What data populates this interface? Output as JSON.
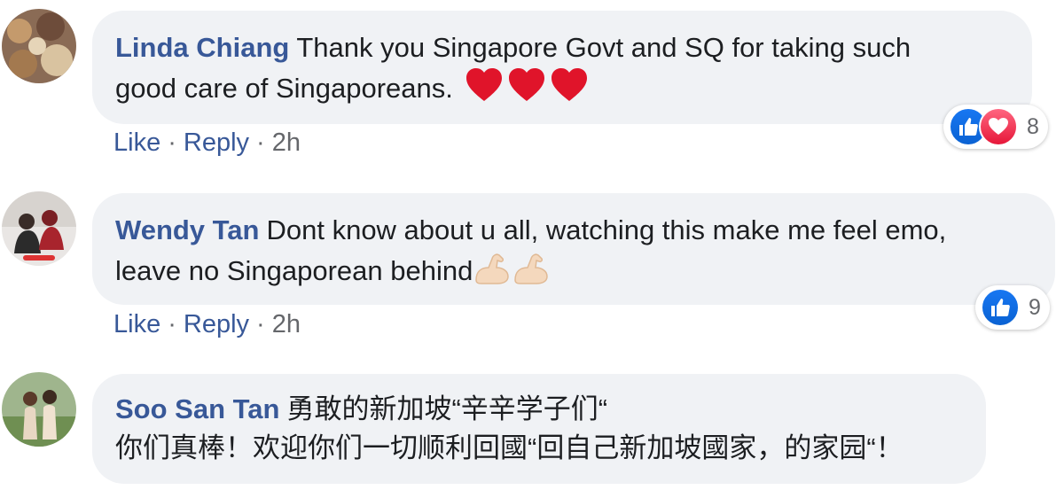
{
  "comments": [
    {
      "author": "Linda Chiang",
      "text_line1": "Thank you Singapore Govt and SQ for taking such",
      "text_line2": "good care of Singaporeans.",
      "emojis": [
        "red-heart-emoji",
        "red-heart-emoji",
        "red-heart-emoji"
      ],
      "actions": {
        "like": "Like",
        "reply": "Reply",
        "time": "2h"
      },
      "reactions": {
        "icons": [
          "like-icon",
          "love-icon"
        ],
        "count": "8"
      }
    },
    {
      "author": "Wendy Tan",
      "text_line1": "Dont know about u all, watching this make me feel emo,",
      "text_line2": "leave no Singaporean behind",
      "emojis": [
        "flexed-biceps-emoji",
        "flexed-biceps-emoji"
      ],
      "actions": {
        "like": "Like",
        "reply": "Reply",
        "time": "2h"
      },
      "reactions": {
        "icons": [
          "like-icon"
        ],
        "count": "9"
      }
    },
    {
      "author": "Soo San Tan",
      "text_line1": "勇敢的新加坡“辛辛学子们“",
      "text_line2": "你们真棒！欢迎你们一切顺利回國“回自己新加坡國家，的家园“！"
    }
  ],
  "separator": "·",
  "colors": {
    "author": "#385898",
    "bubble": "#f0f2f5",
    "meta": "#65676b",
    "like": "#1877f2",
    "love": "#e61739"
  }
}
